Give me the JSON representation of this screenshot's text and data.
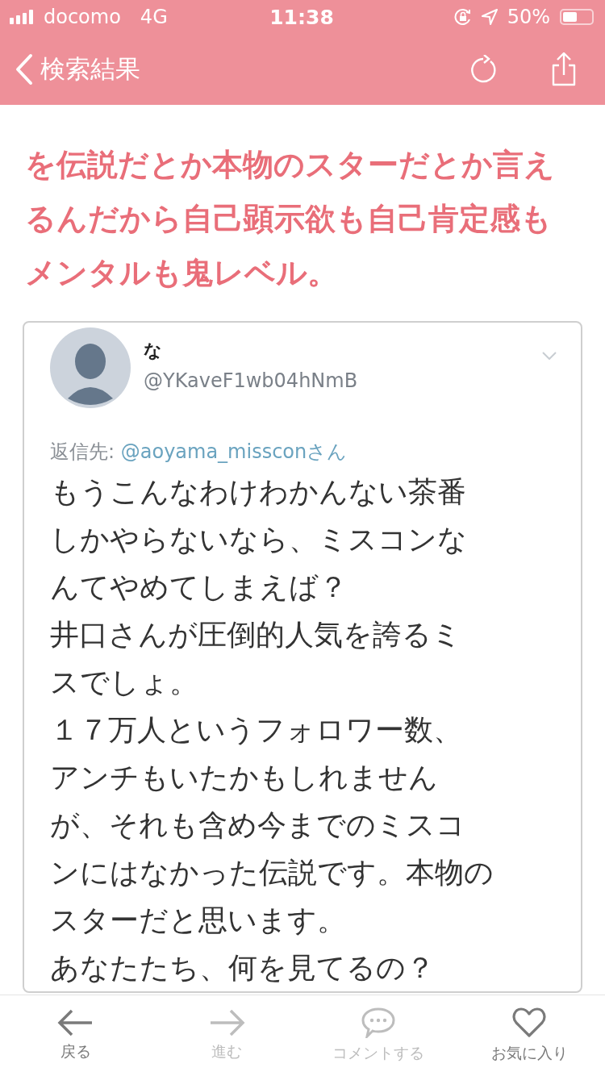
{
  "status_bar": {
    "carrier": "docomo",
    "network": "4G",
    "time": "11:38",
    "battery": "50%",
    "level": 0.5
  },
  "nav_bar": {
    "back_label": "検索結果"
  },
  "heading_lines": [
    "を伝説だとか本物のスターだとか言え",
    "るんだから自己顕示欲も自己肯定感も",
    "メンタルも鬼レベル。"
  ],
  "tweet": {
    "name": "な",
    "handle": "@YKaveF1wb04hNmB",
    "reply_label": "返信先:",
    "reply_to": "@aoyama_missconさん",
    "lines": [
      "もうこんなわけわかんない茶番",
      "しかやらないなら、ミスコンな",
      "んてやめてしまえば？",
      "井口さんが圧倒的人気を誇るミ",
      "スでしょ。",
      "１７万人というフォロワー数、",
      "アンチもいたかもしれません",
      "が、それも含め今までのミスコ",
      "ンにはなかった伝説です。本物の",
      "スターだと思います。",
      "あなたたち、何を見てるの？"
    ]
  },
  "tab_bar": [
    {
      "kind": "back",
      "label": "戻る",
      "disabled": false
    },
    {
      "kind": "forward",
      "label": "進む",
      "disabled": true
    },
    {
      "kind": "comment",
      "label": "コメントする",
      "disabled": true
    },
    {
      "kind": "favorite",
      "label": "お気に入り",
      "disabled": false
    }
  ]
}
